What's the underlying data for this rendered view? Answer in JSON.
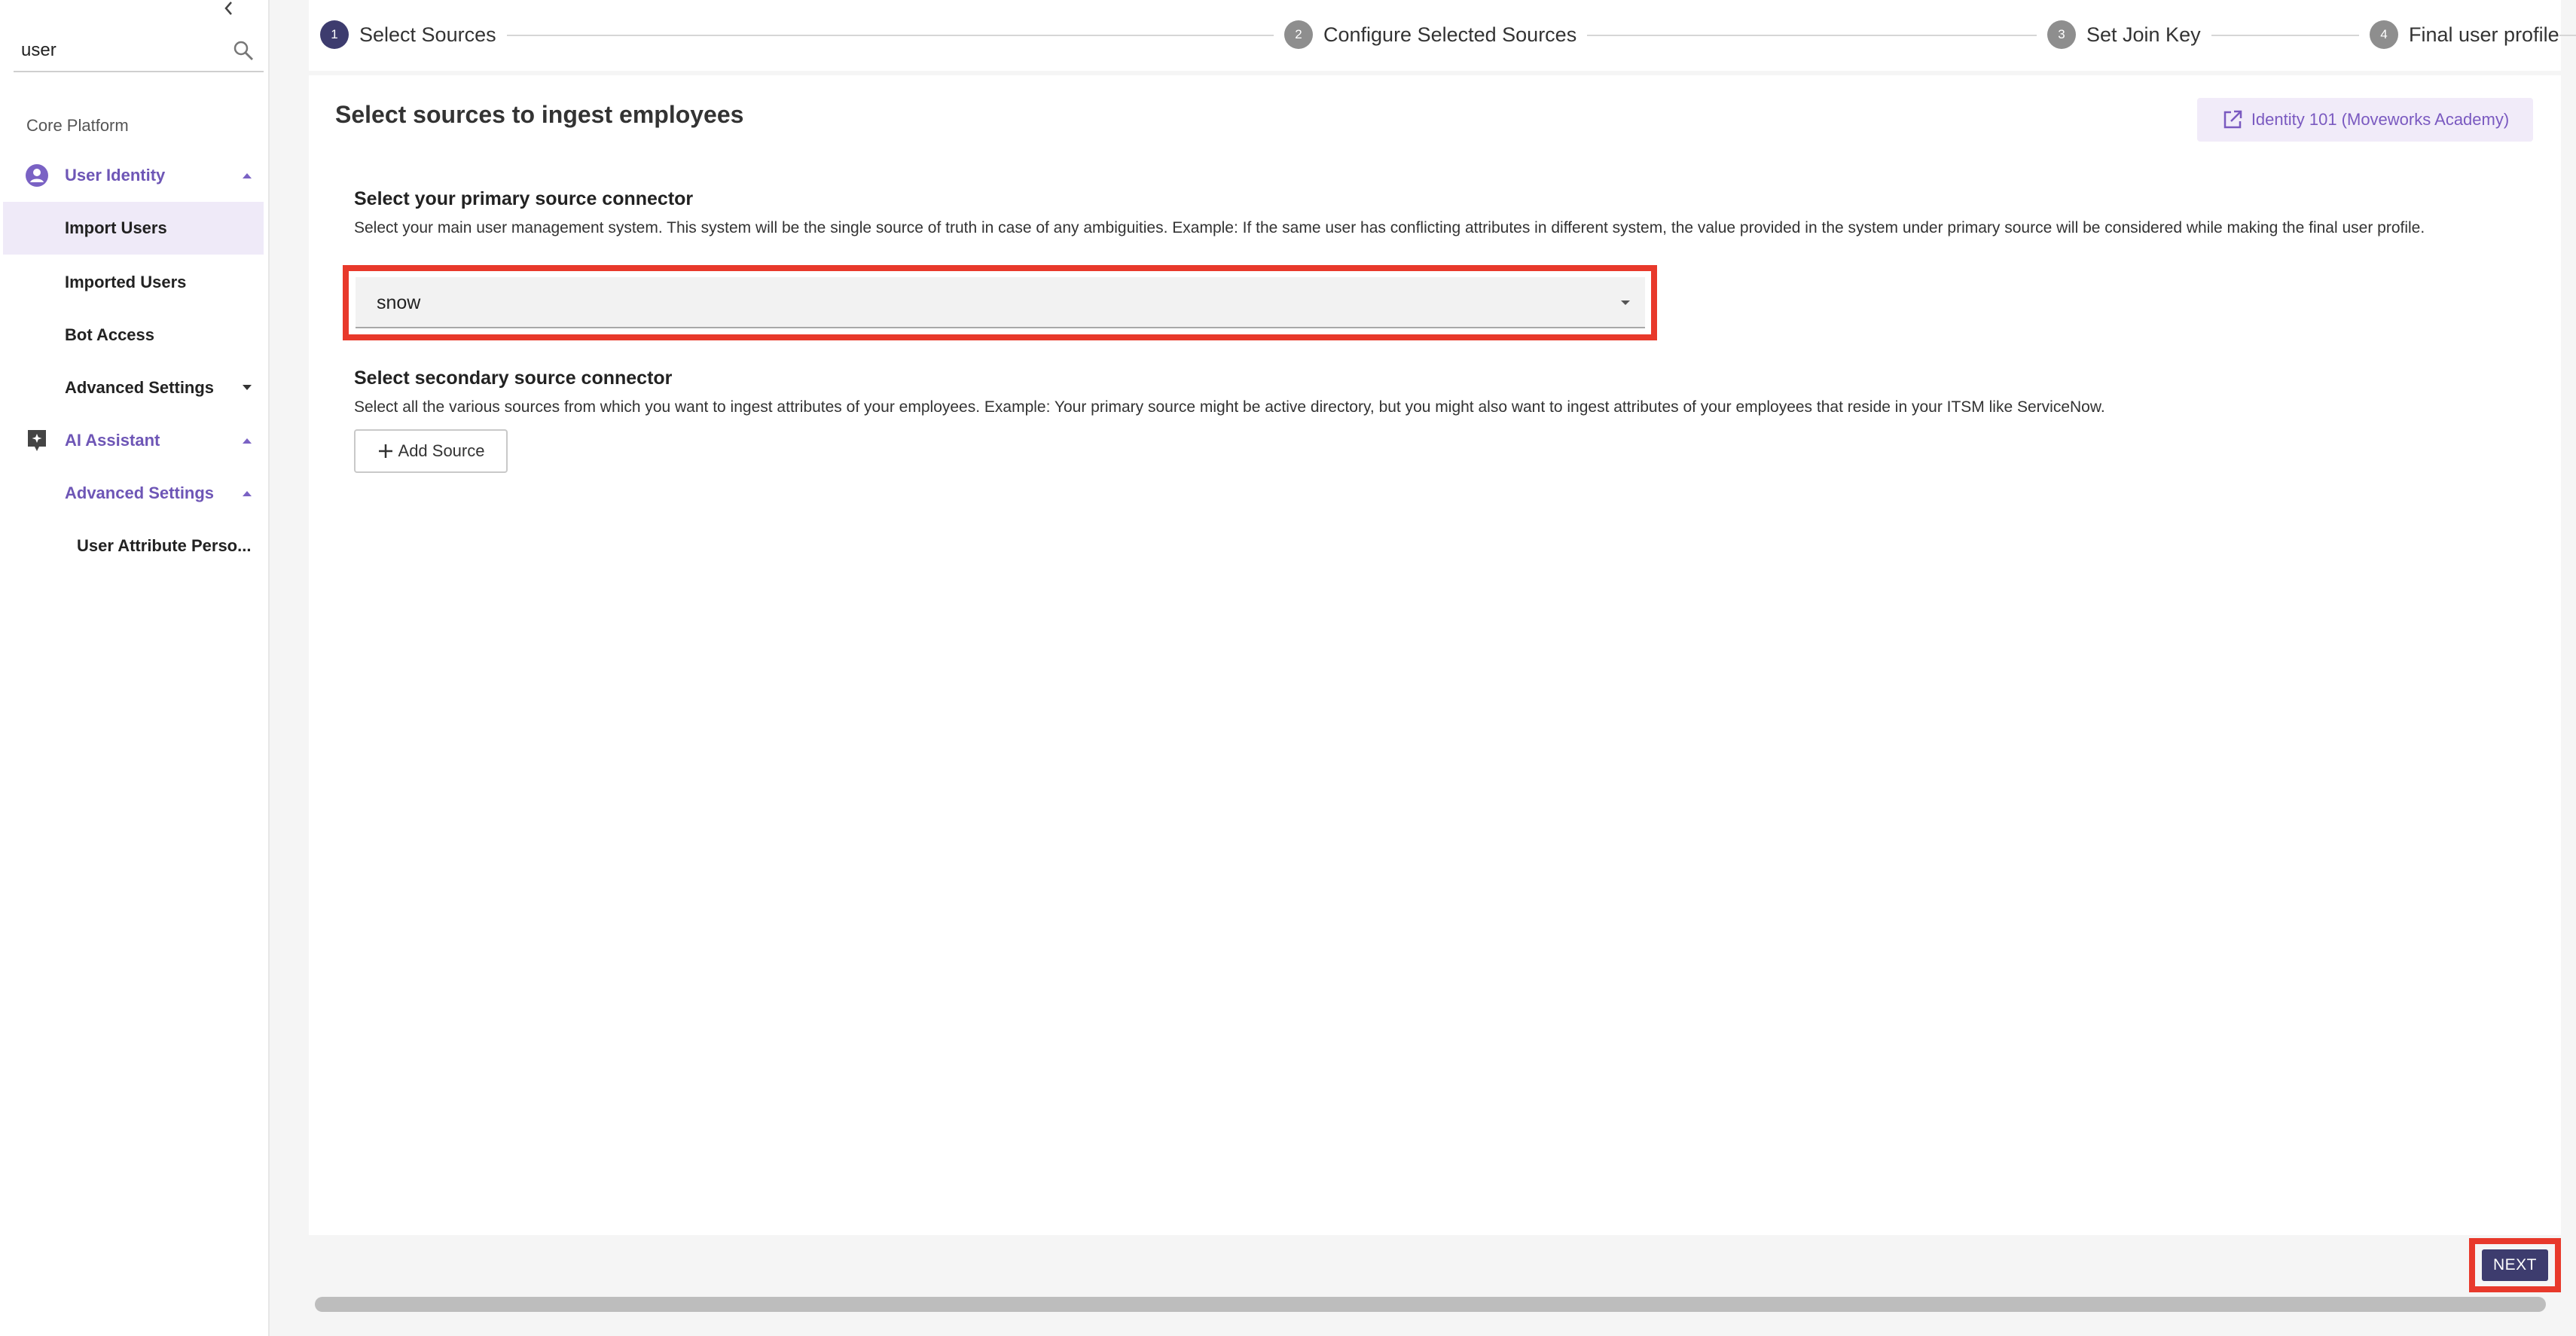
{
  "sidebar": {
    "search": {
      "value": "user",
      "placeholder": "Search"
    },
    "section_label": "Core Platform",
    "items": [
      {
        "label": "User Identity"
      },
      {
        "label": "Import Users"
      },
      {
        "label": "Imported Users"
      },
      {
        "label": "Bot Access"
      },
      {
        "label": "Advanced Settings"
      },
      {
        "label": "AI Assistant"
      },
      {
        "label": "Advanced Settings"
      },
      {
        "label": "User Attribute Perso..."
      }
    ]
  },
  "stepper": {
    "steps": [
      {
        "num": "1",
        "label": "Select Sources"
      },
      {
        "num": "2",
        "label": "Configure Selected Sources"
      },
      {
        "num": "3",
        "label": "Set Join Key"
      },
      {
        "num": "4",
        "label": "Final user profile"
      }
    ]
  },
  "main": {
    "title": "Select sources to ingest employees",
    "academy_link": "Identity 101 (Moveworks Academy)",
    "primary": {
      "title": "Select your primary source connector",
      "description": "Select your main user management system. This system will be the single source of truth in case of any ambiguities. Example: If the same user has conflicting attributes in different system, the value provided in the system under primary source will be considered while making the final user profile.",
      "selected": "snow"
    },
    "secondary": {
      "title": "Select secondary source connector",
      "description": "Select all the various sources from which you want to ingest attributes of your employees. Example: Your primary source might be active directory, but you might also want to ingest attributes of your employees that reside in your ITSM like ServiceNow.",
      "add_button": "Add Source"
    }
  },
  "footer": {
    "next_label": "NEXT"
  },
  "colors": {
    "accent": "#6e56b6",
    "primary_button": "#3d3c6e",
    "highlight": "#e8392b"
  }
}
